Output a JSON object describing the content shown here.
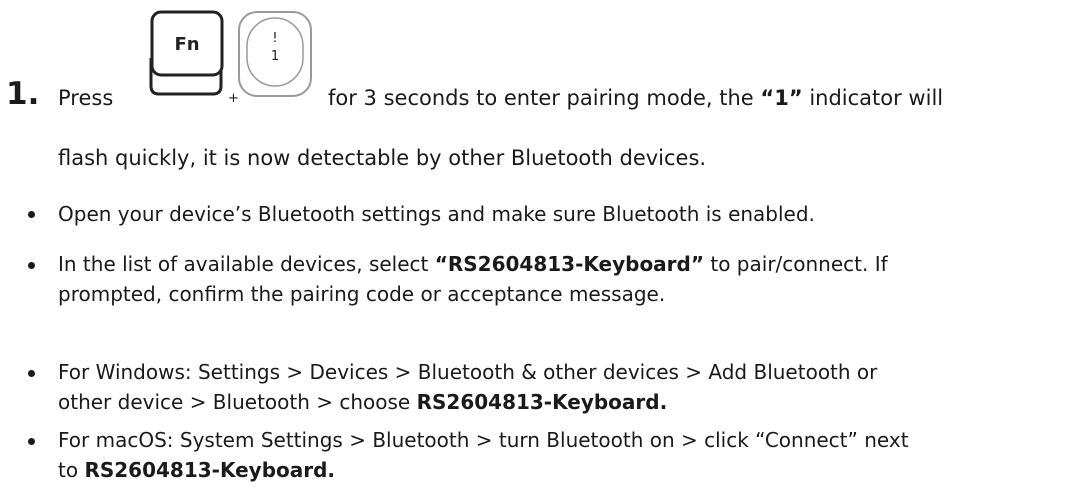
{
  "step": {
    "number": "1.",
    "press": "Press",
    "key_fn": "Fn",
    "plus": "+",
    "key_1_top": "!",
    "key_1_bottom": "1",
    "text_a": "for 3 seconds to enter pairing mode, the ",
    "text_bold": "“1”",
    "text_b": " indicator will",
    "continuation": "flash quickly, it is now detectable by other Bluetooth devices."
  },
  "bullets": [
    {
      "a": "Open your device’s Bluetooth settings and make sure Bluetooth is enabled."
    },
    {
      "a": "In the list of available devices, select ",
      "bold": "“RS2604813-Keyboard”",
      "b": " to pair/connect. If",
      "line2": "prompted, confirm the pairing code or acceptance message."
    },
    {
      "a": "For Windows: Settings > Devices > Bluetooth & other devices > Add Bluetooth or",
      "line2": "other device > Bluetooth > choose ",
      "bold": "RS2604813-Keyboard."
    },
    {
      "a": "For macOS: System Settings > Bluetooth > turn Bluetooth on > click “Connect” next",
      "line2": "to ",
      "bold": "RS2604813-Keyboard."
    }
  ],
  "icons": {
    "fn_key": "fn-key-icon",
    "one_key": "one-key-icon"
  },
  "colors": {
    "text": "#1a1a1a",
    "key_stroke": "#222222",
    "key_light_stroke": "#9a9a9a"
  }
}
